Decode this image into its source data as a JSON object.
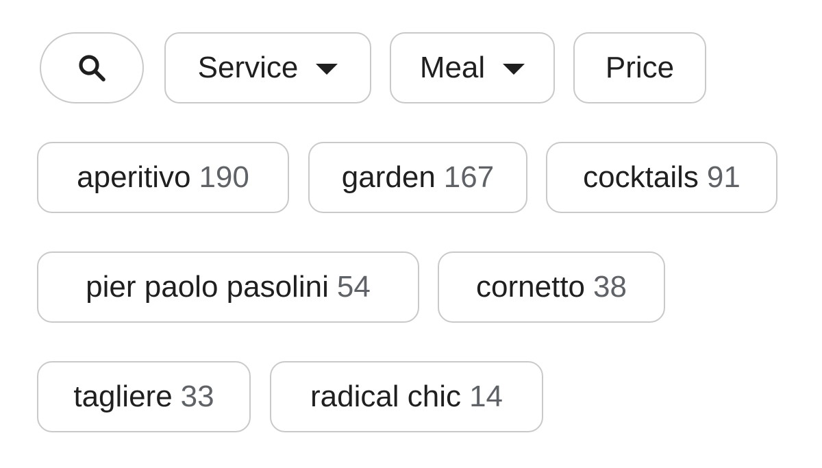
{
  "filters": {
    "search": {
      "icon": "search-icon"
    },
    "service": {
      "label": "Service",
      "icon": "caret-down-icon"
    },
    "meal": {
      "label": "Meal",
      "icon": "caret-down-icon"
    },
    "price": {
      "label": "Price"
    }
  },
  "tags": [
    {
      "label": "aperitivo",
      "count": "190"
    },
    {
      "label": "garden",
      "count": "167"
    },
    {
      "label": "cocktails",
      "count": "91"
    },
    {
      "label": "pier paolo pasolini",
      "count": "54"
    },
    {
      "label": "cornetto",
      "count": "38"
    },
    {
      "label": "tagliere",
      "count": "33"
    },
    {
      "label": "radical chic",
      "count": "14"
    }
  ]
}
